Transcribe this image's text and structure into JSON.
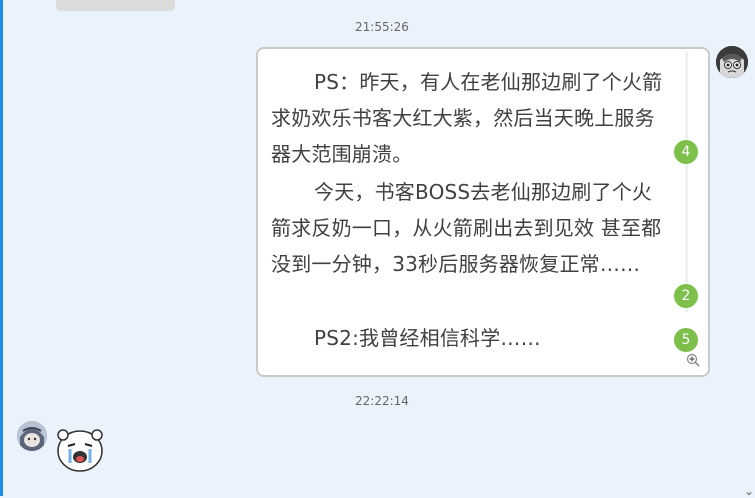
{
  "chat": {
    "timestamps": [
      "21:55:26",
      "22:22:14"
    ],
    "message": {
      "paragraphs": [
        {
          "text": "PS：昨天，有人在老仙那边刷了个火箭求奶欢乐书客大红大紫，然后当天晚上服务器大范围崩溃。",
          "reaction_count": "4"
        },
        {
          "text": "今天，书客BOSS去老仙那边刷了个火箭求反奶一口，从火箭刷出去到见效 甚至都没到一分钟，33秒后服务器恢复正常……",
          "reaction_count": "2"
        },
        {
          "text": "PS2:我曾经相信科学……",
          "reaction_count": "5"
        }
      ]
    }
  },
  "icons": {
    "self_avatar": "user-avatar-icon",
    "other_avatar": "user-avatar-icon",
    "zoom": "zoom-in-icon",
    "sticker": "crying-bear-sticker-icon",
    "chevron": "chevron-down-icon"
  },
  "colors": {
    "accent": "#1d8ee6",
    "reaction_badge": "#7cbf4b",
    "background": "#eaf3fc",
    "bubble_bg": "#ffffff"
  }
}
